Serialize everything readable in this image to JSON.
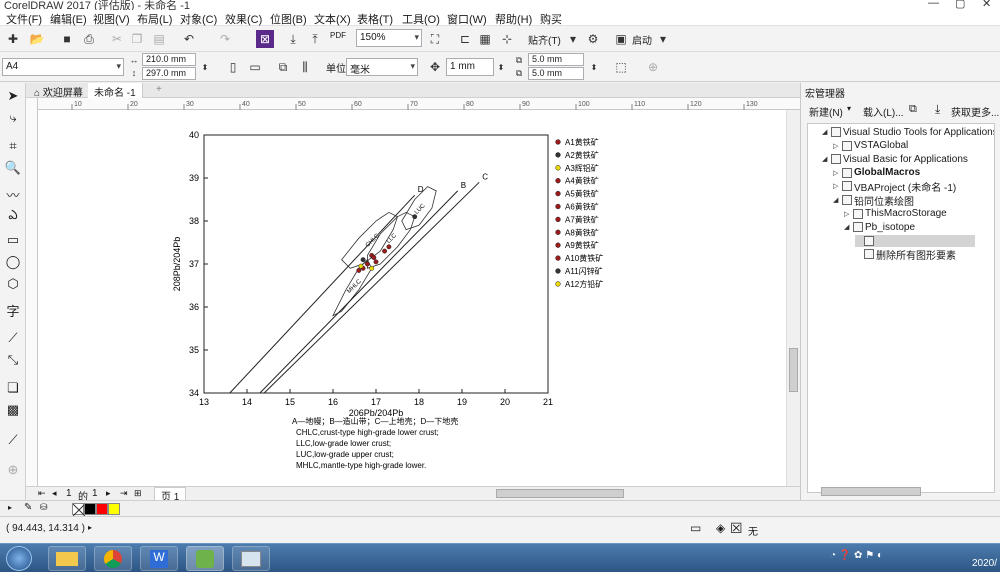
{
  "window": {
    "title": "CorelDRAW 2017 (评估版) - 未命名 -1"
  },
  "menu": [
    "文件(F)",
    "编辑(E)",
    "视图(V)",
    "布局(L)",
    "对象(C)",
    "效果(C)",
    "位图(B)",
    "文本(X)",
    "表格(T)",
    "工具(O)",
    "窗口(W)",
    "帮助(H)",
    "购买"
  ],
  "toolbar": {
    "pdf_label": "PDF",
    "zoom": "150%",
    "snap_label": "贴齐(T)",
    "launch_label": "启动"
  },
  "property_bar": {
    "page_size": "A4",
    "width": "210.0 mm",
    "height": "297.0 mm",
    "units_label": "单位:",
    "units": "毫米",
    "nudge": "1 mm",
    "dup_x": "5.0 mm",
    "dup_y": "5.0 mm"
  },
  "doc_tabs": {
    "welcome": "欢迎屏幕",
    "doc": "未命名 -1"
  },
  "ruler": {
    "labels": [
      "10",
      "20",
      "30",
      "40",
      "50",
      "60",
      "70",
      "80",
      "90",
      "100",
      "110",
      "120",
      "130"
    ]
  },
  "chart_data": {
    "type": "line",
    "xlabel": "206Pb/204Pb",
    "ylabel": "208Pb/204Pb",
    "xlim": [
      13,
      21
    ],
    "ylim": [
      34,
      40
    ],
    "xticks": [
      "13",
      "14",
      "15",
      "16",
      "17",
      "18",
      "19",
      "20",
      "21"
    ],
    "yticks": [
      "34",
      "35",
      "36",
      "37",
      "38",
      "39",
      "40"
    ],
    "curves": [
      {
        "name": "C",
        "points": [
          [
            14.4,
            34.0
          ],
          [
            19.4,
            38.9
          ]
        ]
      },
      {
        "name": "B",
        "points": [
          [
            14.3,
            34.0
          ],
          [
            18.9,
            38.7
          ]
        ]
      },
      {
        "name": "D",
        "points": [
          [
            13.6,
            34.0
          ],
          [
            17.9,
            38.6
          ]
        ]
      }
    ],
    "regions": [
      {
        "name": "CHLC",
        "points": [
          [
            16.2,
            37.1
          ],
          [
            16.6,
            37.6
          ],
          [
            17.0,
            38.0
          ],
          [
            17.3,
            38.2
          ],
          [
            17.5,
            38.1
          ],
          [
            17.4,
            37.8
          ],
          [
            17.1,
            37.3
          ],
          [
            16.7,
            37.0
          ],
          [
            16.4,
            36.9
          ]
        ]
      },
      {
        "name": "LLC",
        "points": [
          [
            16.8,
            37.2
          ],
          [
            17.1,
            37.7
          ],
          [
            17.5,
            38.1
          ],
          [
            17.7,
            38.2
          ],
          [
            17.9,
            38.1
          ],
          [
            17.8,
            37.8
          ],
          [
            17.5,
            37.4
          ],
          [
            17.1,
            37.0
          ],
          [
            16.8,
            36.9
          ]
        ]
      },
      {
        "name": "LUC",
        "points": [
          [
            17.6,
            38.0
          ],
          [
            17.9,
            38.5
          ],
          [
            18.2,
            38.8
          ],
          [
            18.4,
            38.7
          ],
          [
            18.3,
            38.3
          ],
          [
            18.0,
            37.9
          ],
          [
            17.7,
            37.8
          ]
        ]
      },
      {
        "name": "MHLC",
        "points": [
          [
            16.0,
            35.8
          ],
          [
            16.3,
            36.4
          ],
          [
            16.6,
            36.9
          ],
          [
            16.8,
            37.1
          ],
          [
            16.9,
            36.9
          ],
          [
            16.6,
            36.4
          ],
          [
            16.2,
            35.9
          ]
        ]
      }
    ],
    "series": [
      {
        "name": "A1黄铁矿",
        "color": "#9b1b1b",
        "points": [
          [
            16.9,
            37.2
          ]
        ]
      },
      {
        "name": "A2黄铁矿",
        "color": "#333333",
        "points": [
          [
            16.7,
            37.1
          ]
        ]
      },
      {
        "name": "A3辉铝矿",
        "color": "#e8d800",
        "points": [
          [
            16.9,
            36.9
          ]
        ]
      },
      {
        "name": "A4黄铁矿",
        "color": "#9b1b1b",
        "points": [
          [
            17.2,
            37.3
          ]
        ]
      },
      {
        "name": "A5黄铁矿",
        "color": "#9b1b1b",
        "points": [
          [
            16.8,
            37.0
          ]
        ]
      },
      {
        "name": "A6黄铁矿",
        "color": "#9b1b1b",
        "points": [
          [
            16.6,
            36.85
          ]
        ]
      },
      {
        "name": "A7黄铁矿",
        "color": "#9b1b1b",
        "points": [
          [
            17.0,
            37.05
          ]
        ]
      },
      {
        "name": "A8黄铁矿",
        "color": "#9b1b1b",
        "points": [
          [
            16.7,
            36.9
          ]
        ]
      },
      {
        "name": "A9黄铁矿",
        "color": "#9b1b1b",
        "points": [
          [
            17.3,
            37.4
          ]
        ]
      },
      {
        "name": "A10黄铁矿",
        "color": "#9b1b1b",
        "points": [
          [
            16.95,
            37.15
          ]
        ]
      },
      {
        "name": "A11闪锌矿",
        "color": "#333333",
        "points": [
          [
            17.9,
            38.1
          ]
        ]
      },
      {
        "name": "A12方铅矿",
        "color": "#e8d800",
        "points": [
          [
            16.65,
            36.95
          ]
        ]
      }
    ],
    "notes": [
      "A—地幔；B—造山带；C—上地壳；D—下地壳",
      "CHLC,crust-type high-grade lower crust;",
      "LLC,low-grade lower crust;",
      "LUC,low-grade upper crust;",
      "MHLC,mantle-type high-grade lower."
    ]
  },
  "page_nav": {
    "current": "1",
    "of": "的",
    "total": "1",
    "tab": "页 1"
  },
  "macro_panel": {
    "title": "宏管理器",
    "new_label": "新建(N)",
    "load_label": "载入(L)...",
    "get_more": "获取更多...",
    "tree": [
      {
        "label": "Visual Studio Tools for Applications",
        "level": 0,
        "expanded": true,
        "bold": false
      },
      {
        "label": "VSTAGlobal",
        "level": 1,
        "expanded": false,
        "bold": false
      },
      {
        "label": "Visual Basic for Applications",
        "level": 0,
        "expanded": true,
        "bold": false
      },
      {
        "label": "GlobalMacros",
        "level": 1,
        "expanded": false,
        "bold": true
      },
      {
        "label": "VBAProject (未命名 -1)",
        "level": 1,
        "expanded": false,
        "bold": false
      },
      {
        "label": "铅同位素绘图",
        "level": 1,
        "expanded": true,
        "bold": false
      },
      {
        "label": "ThisMacroStorage",
        "level": 2,
        "expanded": false,
        "bold": false
      },
      {
        "label": "Pb_isotope",
        "level": 2,
        "expanded": true,
        "bold": false
      },
      {
        "label": "",
        "level": 3,
        "expanded": false,
        "bold": false,
        "selected": true
      },
      {
        "label": "删除所有图形要素",
        "level": 3,
        "expanded": false,
        "bold": false
      }
    ]
  },
  "status": {
    "coords": "( 94.443, 14.314 )",
    "fill_none": "无"
  },
  "palette": {
    "colors": [
      "#ffffff",
      "#000000",
      "#ff0000",
      "#ffff00"
    ]
  },
  "taskbar": {
    "clock": "2020/"
  }
}
